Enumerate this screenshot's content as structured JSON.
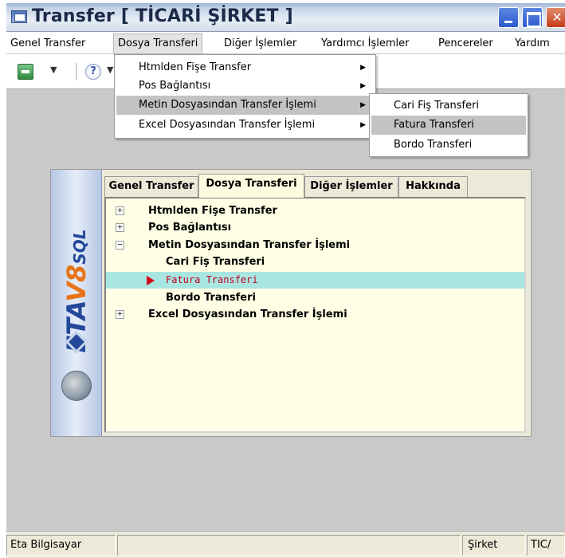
{
  "window": {
    "title": "Transfer [ TİCARİ ŞİRKET ]"
  },
  "menubar": {
    "items": [
      "Genel Transfer",
      "Dosya Transferi",
      "Diğer İşlemler",
      "Yardımcı İşlemler",
      "Pencereler",
      "Yardım"
    ]
  },
  "toolbar": {
    "help_glyph": "?"
  },
  "dropdown": {
    "items": [
      "Htmlden Fişe Transfer",
      "Pos Bağlantısı",
      "Metin Dosyasından Transfer İşlemi",
      "Excel Dosyasından Transfer İşlemi"
    ],
    "arrow": "▶"
  },
  "submenu": {
    "items": [
      "Cari Fiş Transferi",
      "Fatura Transferi",
      "Bordo Transferi"
    ]
  },
  "inner": {
    "logo": {
      "eta": "ETA",
      "v8": "V8",
      "sql": "SQL"
    },
    "tabs": [
      "Genel Transfer",
      "Dosya Transferi",
      "Diğer İşlemler",
      "Hakkında"
    ],
    "tree": {
      "nodes": [
        {
          "label": "Htmlden Fişe Transfer",
          "expander": "+"
        },
        {
          "label": "Pos Bağlantısı",
          "expander": "+"
        },
        {
          "label": "Metin Dosyasından Transfer İşlemi",
          "expander": "−"
        },
        {
          "label": "Cari Fiş Transferi"
        },
        {
          "label": "Fatura Transferi"
        },
        {
          "label": "Bordo Transferi"
        },
        {
          "label": "Excel Dosyasından Transfer İşlemi",
          "expander": "+"
        }
      ]
    }
  },
  "statusbar": {
    "company": "Eta Bilgisayar",
    "label": "Şirket",
    "value": "TIC/"
  },
  "colors": {
    "selection": "#a9e6e1",
    "tree_bg": "#ffffe5",
    "workspace": "#c9c9c9",
    "selected_text": "#c0001a"
  }
}
